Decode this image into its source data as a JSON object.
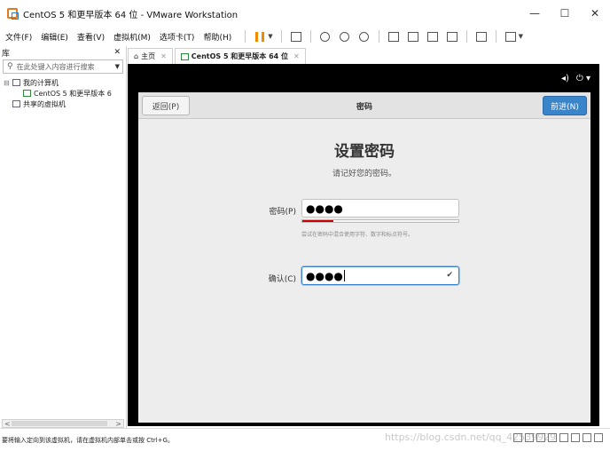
{
  "window": {
    "title": "CentOS 5 和更早版本 64 位 - VMware Workstation",
    "controls": {
      "minimize": "—",
      "maximize": "☐",
      "close": "✕"
    }
  },
  "menubar": {
    "items": [
      "文件(F)",
      "编辑(E)",
      "查看(V)",
      "虚拟机(M)",
      "选项卡(T)",
      "帮助(H)"
    ]
  },
  "library": {
    "title": "库",
    "close": "✕",
    "search_placeholder": "在此处键入内容进行搜索",
    "tree": {
      "my_computer": "我的计算机",
      "vm": "CentOS 5 和更早版本 6",
      "shared": "共享的虚拟机"
    },
    "scroll_left": "<",
    "scroll_right": ">"
  },
  "tabs": [
    {
      "label": "主页",
      "close": "✕"
    },
    {
      "label": "CentOS 5 和更早版本 64 位",
      "close": "✕"
    }
  ],
  "vm_top": {
    "volume": "◂)",
    "power": "⏻ ▾"
  },
  "installer": {
    "back_label": "返回(P)",
    "header_title": "密码",
    "next_label": "前进(N)",
    "heading": "设置密码",
    "subtitle": "请记好您的密码。",
    "password_label": "密码(P)",
    "password_value": "●●●●",
    "confirm_label": "确认(C)",
    "confirm_value": "●●●●",
    "strength_fraction": 0.2,
    "hint": "尝试在密码中混合使用字符、数字和标点符号。",
    "check": "✔"
  },
  "statusbar": {
    "text": "要将输入定向到该虚拟机，请在虚拟机内部单击或按 Ctrl+G。",
    "watermark": "https://blog.csdn.net/qq_42539929"
  },
  "colors": {
    "accent": "#3a84c9",
    "strength_bar": "#cc0000",
    "pause": "#f08a00"
  }
}
